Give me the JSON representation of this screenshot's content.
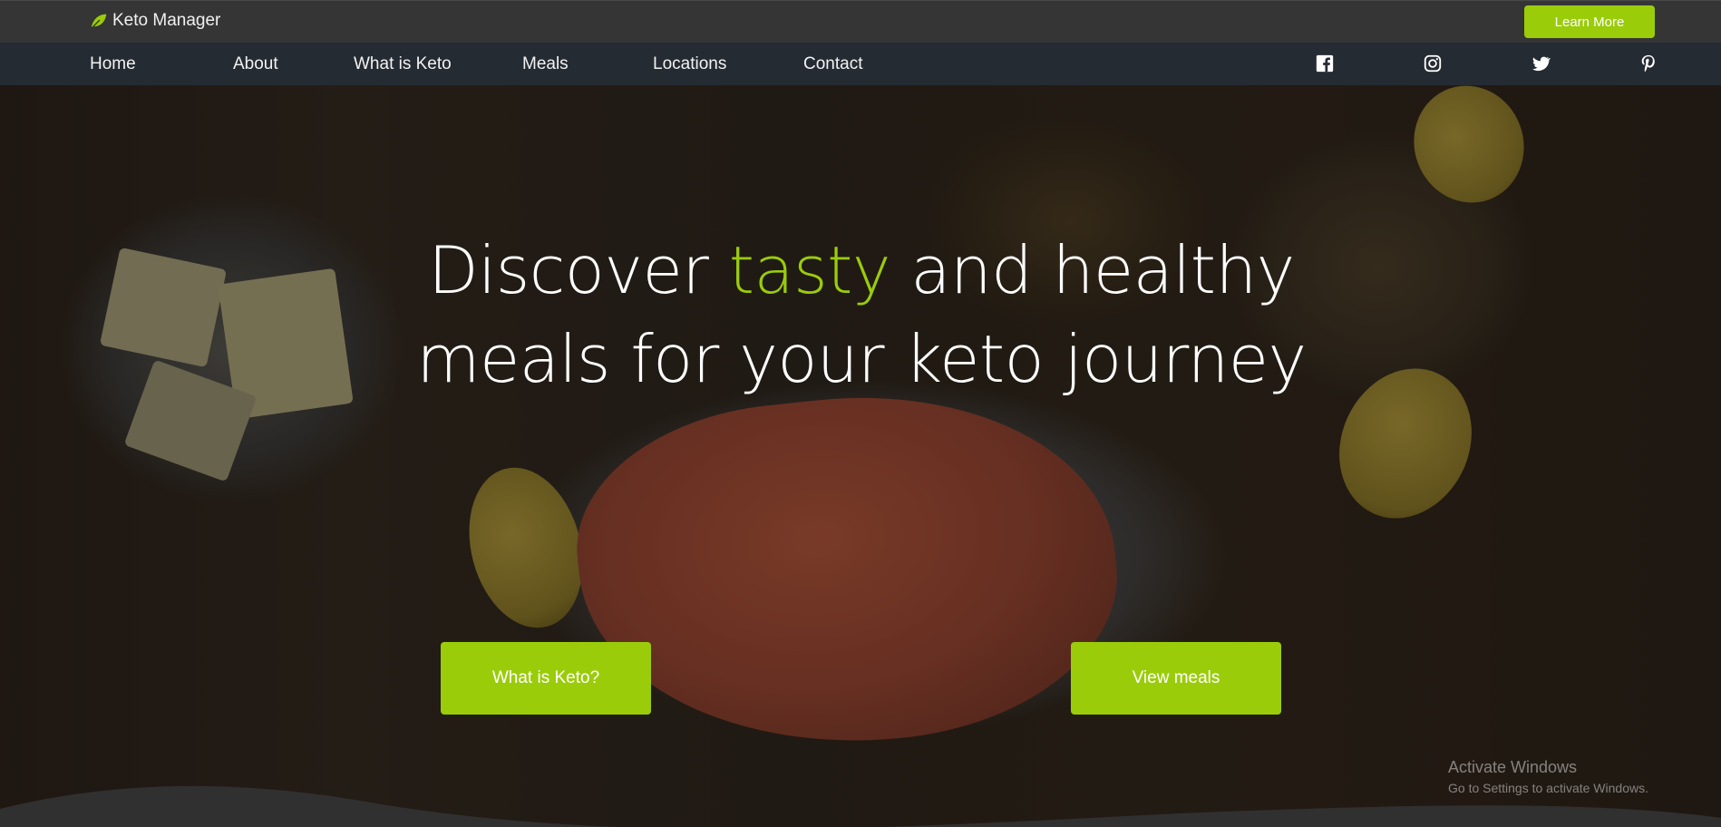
{
  "topbar": {
    "brand": "Keto Manager",
    "learn_more_label": "Learn More"
  },
  "nav": {
    "items": [
      {
        "label": "Home"
      },
      {
        "label": "About"
      },
      {
        "label": "What is Keto"
      },
      {
        "label": "Meals"
      },
      {
        "label": "Locations"
      },
      {
        "label": "Contact"
      }
    ],
    "social_icons": [
      "facebook-icon",
      "instagram-icon",
      "twitter-icon",
      "pinterest-icon"
    ]
  },
  "hero": {
    "headline_part1": "Discover ",
    "headline_accent": "tasty",
    "headline_part2": " and healthy",
    "headline_line2": "meals for your keto journey",
    "cta_primary_label": "What is Keto?",
    "cta_secondary_label": "View meals"
  },
  "watermark": {
    "title": "Activate Windows",
    "subtitle": "Go to Settings to activate Windows."
  },
  "colors": {
    "accent": "#9acc0a",
    "topbar": "#353535",
    "navbar": "#252b33"
  }
}
